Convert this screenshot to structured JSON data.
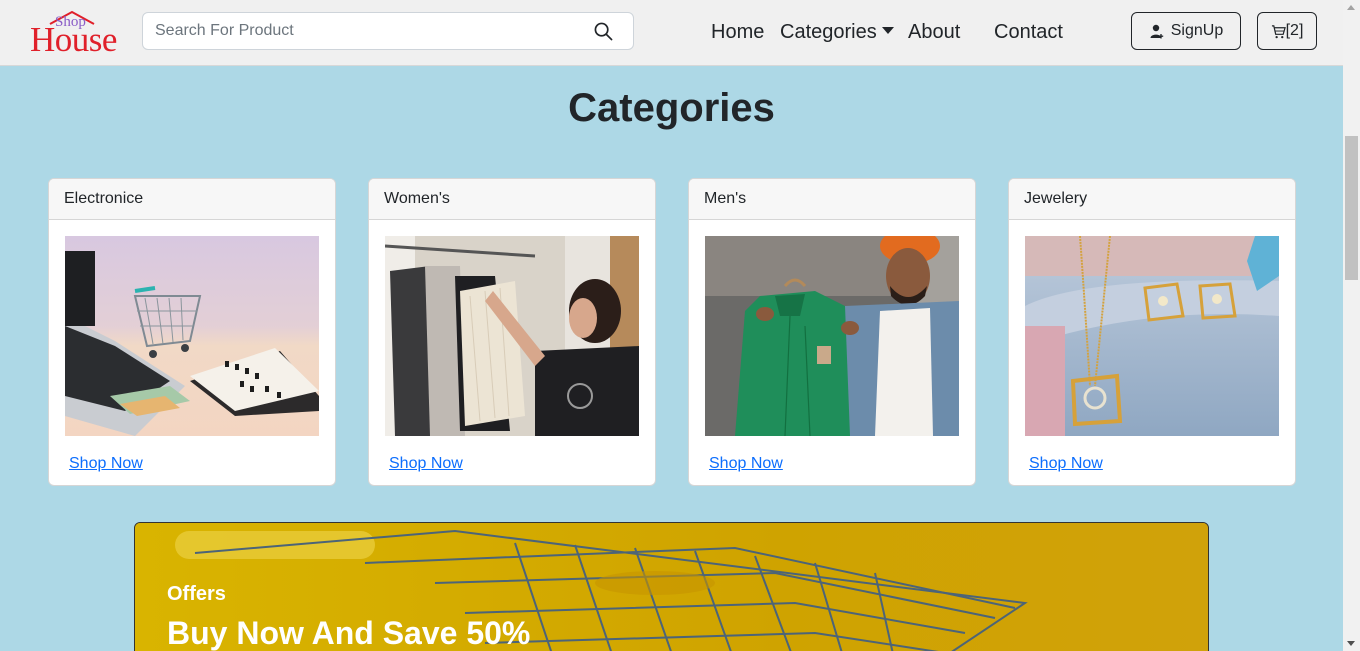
{
  "brand": {
    "top": "Shop",
    "main": "House"
  },
  "search": {
    "placeholder": "Search For Product"
  },
  "nav": {
    "home": "Home",
    "categories": "Categories",
    "about": "About",
    "contact": "Contact"
  },
  "actions": {
    "signup": "SignUp",
    "cart": "[2]"
  },
  "main": {
    "title": "Categories",
    "cards": [
      {
        "label": "Electronice",
        "link": "Shop Now"
      },
      {
        "label": "Women's",
        "link": "Shop Now"
      },
      {
        "label": "Men's",
        "link": "Shop Now"
      },
      {
        "label": "Jewelery",
        "link": "Shop Now"
      }
    ]
  },
  "offer": {
    "small": "Offers",
    "big": "Buy Now And Save 50%"
  },
  "colors": {
    "page_bg": "#add8e6",
    "link": "#0d6efd",
    "brand_red": "#e0202a",
    "banner": "#d4ac00"
  }
}
